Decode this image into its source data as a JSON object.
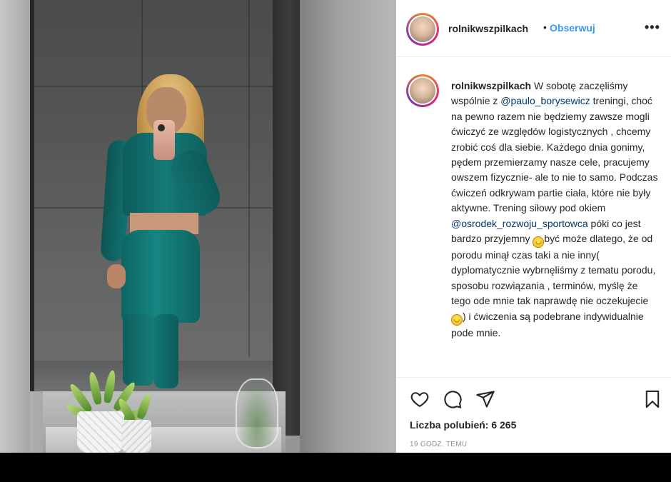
{
  "post": {
    "username": "rolnikwszpilkach",
    "dot": "•",
    "follow_label": "Obserwuj",
    "more_icon": "more-options-icon",
    "more_label": "•••"
  },
  "caption": {
    "username": "rolnikwszpilkach",
    "text_1": "W sobotę zaczęliśmy wspólnie z ",
    "mention_1": "@paulo_borysewicz",
    "text_2": " treningi, choć na pewno razem nie będziemy zawsze mogli ćwiczyć ze względów logistycznych , chcemy zrobić coś dla siebie. Każdego dnia gonimy, pędem przemierzamy nasze cele, pracujemy owszem fizycznie- ale to nie to samo. Podczas ćwiczeń odkrywam partie ciała, które nie były aktywne. Trening siłowy pod okiem ",
    "mention_2": "@osrodek_rozwoju_sportowca",
    "text_3": " póki co jest bardzo przyjemny ",
    "emoji_1": "grinning-face-emoji",
    "text_4": "być może dlatego, że od porodu minął czas taki a nie inny( dyplomatycznie wybrnęliśmy z tematu porodu, sposobu rozwiązania , terminów, myślę że tego ode mnie tak naprawdę nie oczekujecie",
    "emoji_2": "smiling-face-emoji",
    "text_5": ") i ćwiczenia są podebrane indywidualnie pode mnie."
  },
  "actions": {
    "like_icon": "heart-icon",
    "comment_icon": "comment-icon",
    "share_icon": "send-icon",
    "save_icon": "bookmark-icon"
  },
  "likes_label": "Liczba polubień: 6 265",
  "time_label": "19 GODZ. TEMU",
  "photo": {
    "description_icon": "photo-image"
  }
}
